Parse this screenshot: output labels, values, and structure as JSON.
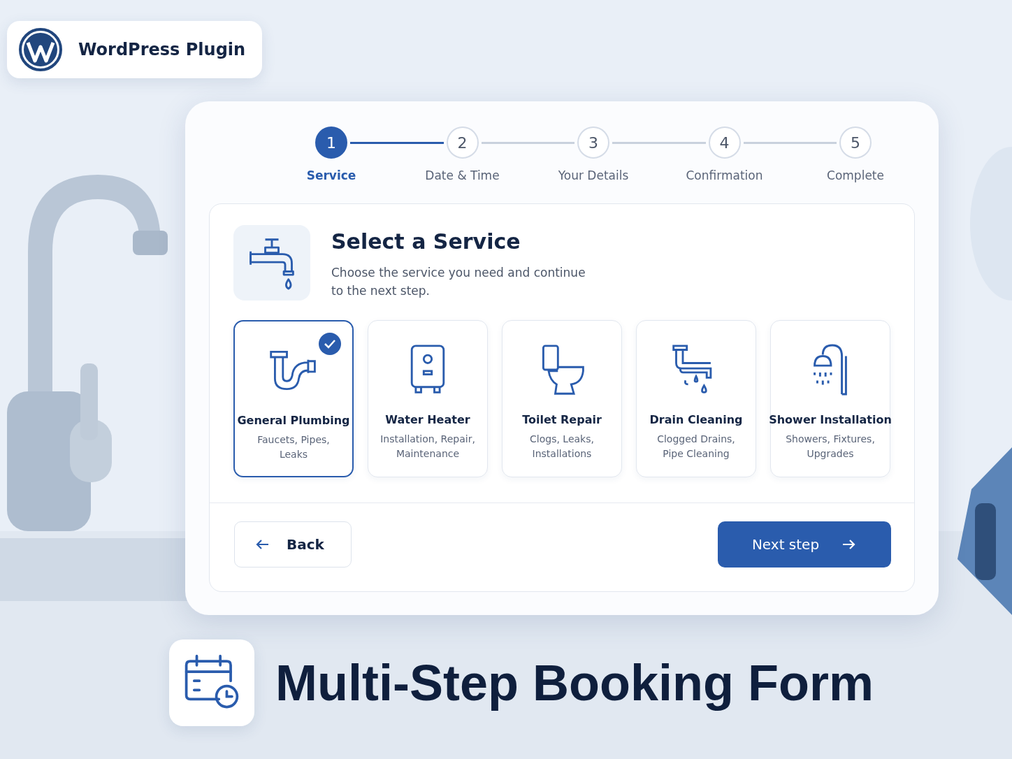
{
  "badge": {
    "label": "WordPress Plugin"
  },
  "steps": [
    {
      "number": "1",
      "label": "Service",
      "selected": true
    },
    {
      "number": "2",
      "label": "Date & Time",
      "selected": false
    },
    {
      "number": "3",
      "label": "Your Details",
      "selected": false
    },
    {
      "number": "4",
      "label": "Confirmation",
      "selected": false
    },
    {
      "number": "5",
      "label": "Complete",
      "selected": false
    }
  ],
  "header": {
    "title": "Select a Service",
    "description": "Choose the service you need and continue to the next step."
  },
  "services": [
    {
      "name": "General Plumbing",
      "details": "Faucets, Pipes, Leaks",
      "selected": true
    },
    {
      "name": "Water Heater",
      "details": "Installation, Repair, Maintenance",
      "selected": false
    },
    {
      "name": "Toilet Repair",
      "details": "Clogs, Leaks, Installations",
      "selected": false
    },
    {
      "name": "Drain Cleaning",
      "details": "Clogged Drains, Pipe Cleaning",
      "selected": false
    },
    {
      "name": "Shower Installation",
      "details": "Showers, Fixtures, Upgrades",
      "selected": false
    }
  ],
  "buttons": {
    "back": "Back",
    "next": "Next step"
  },
  "headline": "Multi-Step Booking Form"
}
